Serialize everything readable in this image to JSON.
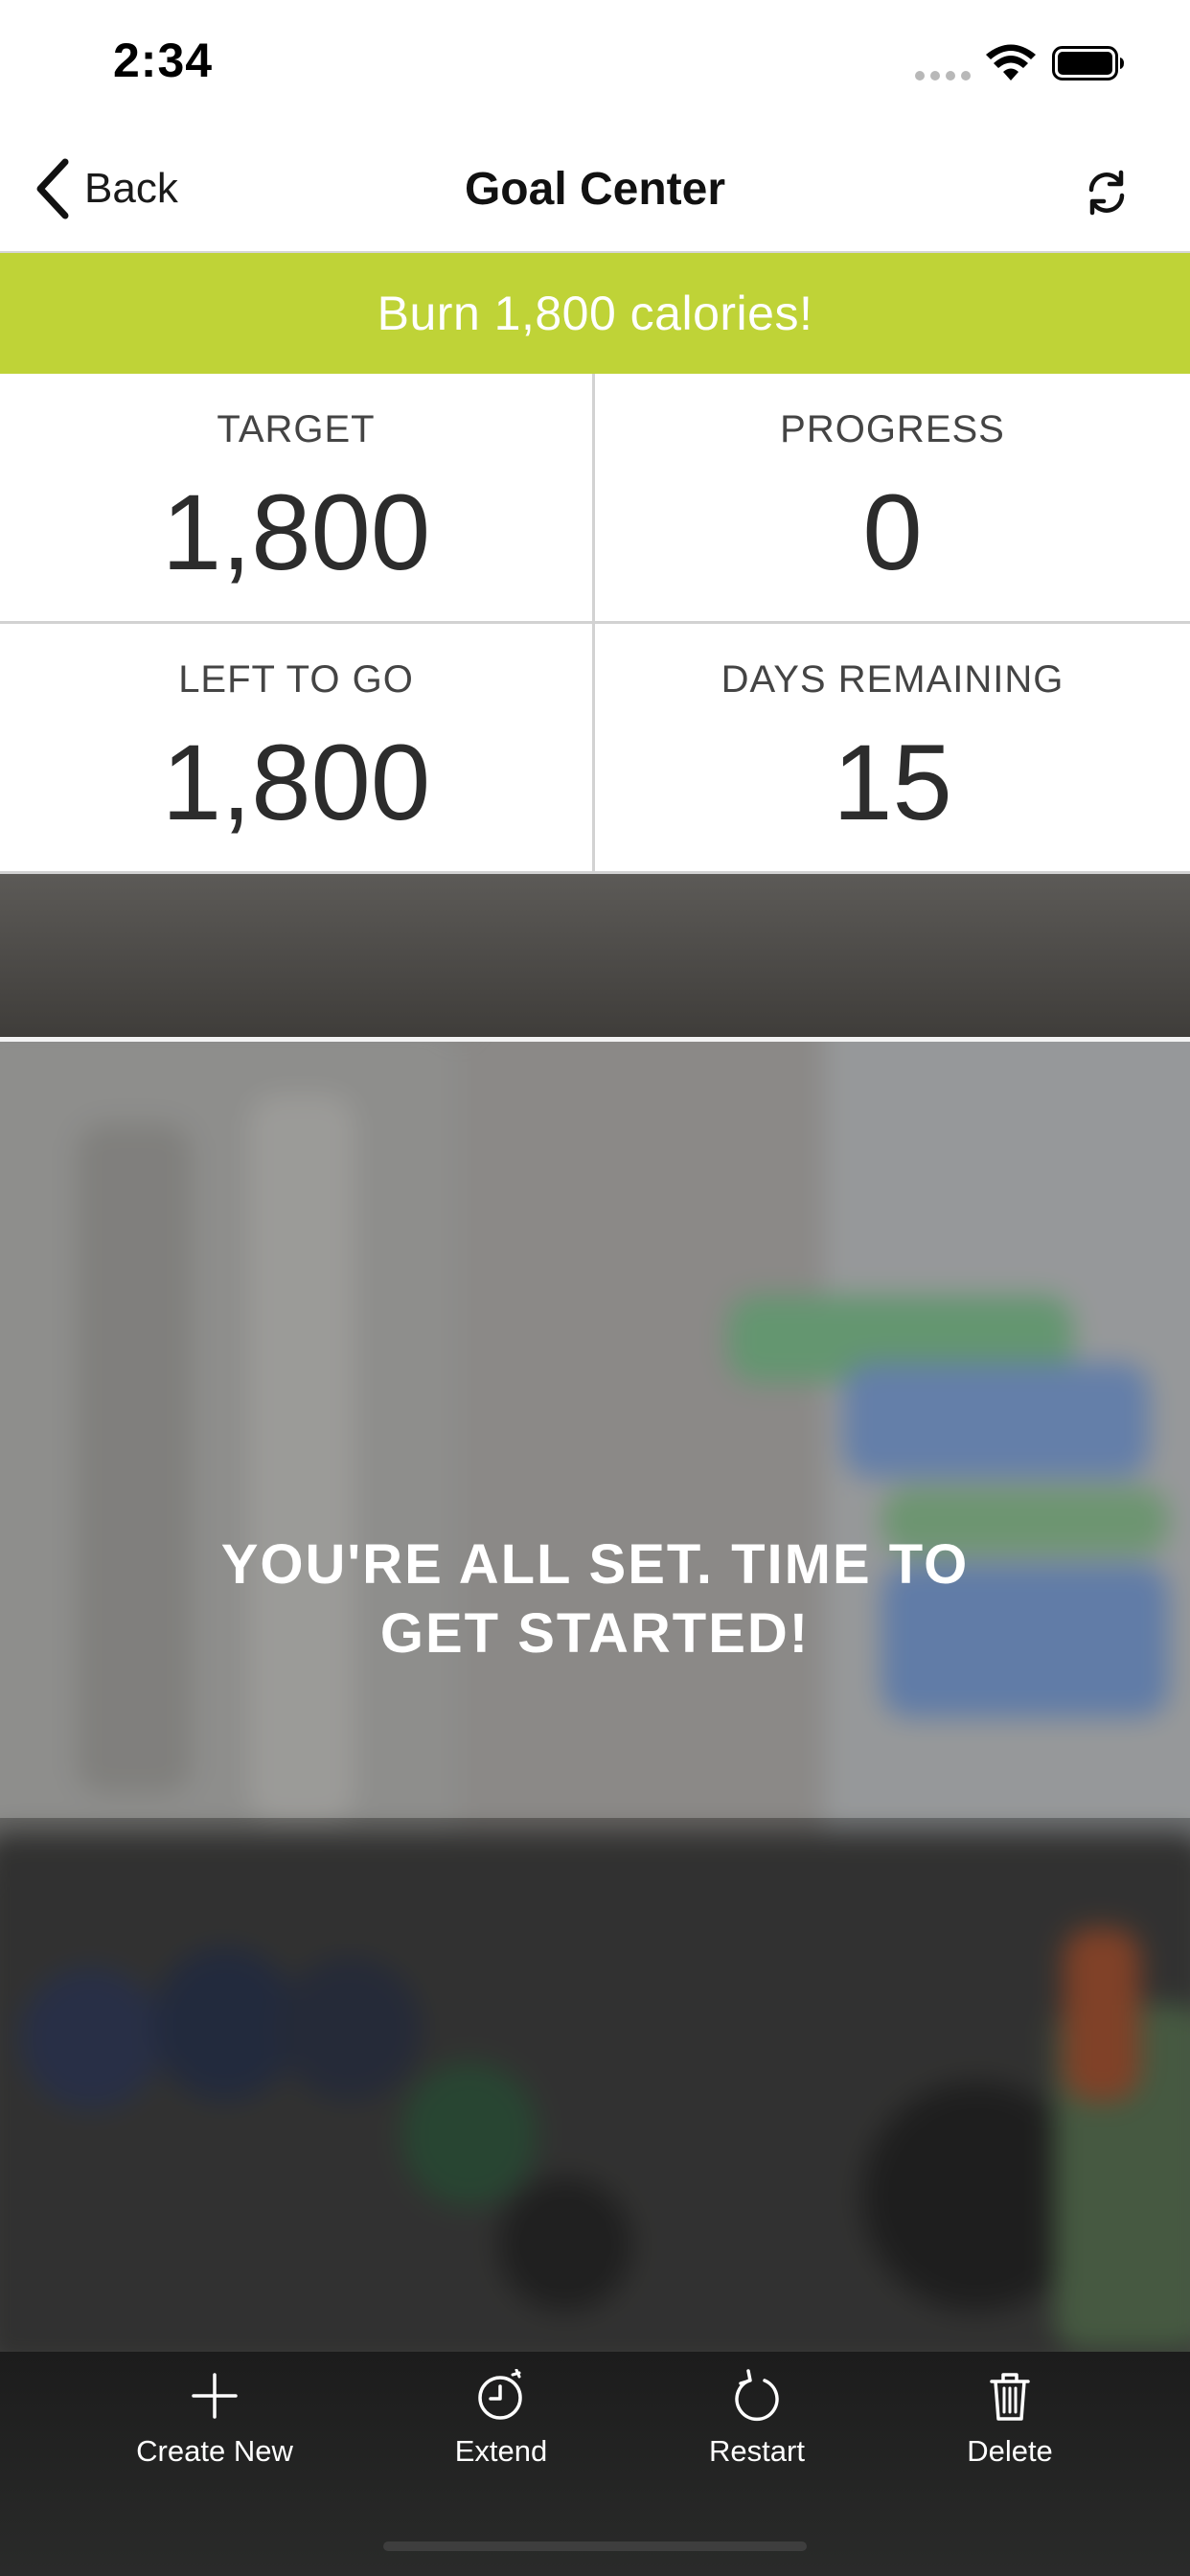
{
  "status_bar": {
    "time": "2:34"
  },
  "nav": {
    "back_label": "Back",
    "title": "Goal Center",
    "refresh_icon": "refresh-icon"
  },
  "goal": {
    "banner": "Burn 1,800 calories!",
    "banner_color": "#bfd337"
  },
  "stats": [
    {
      "label": "TARGET",
      "value": "1,800"
    },
    {
      "label": "PROGRESS",
      "value": "0"
    },
    {
      "label": "LEFT TO GO",
      "value": "1,800"
    },
    {
      "label": "DAYS REMAINING",
      "value": "15"
    }
  ],
  "message": {
    "line1": "YOU'RE ALL SET. TIME TO",
    "line2": "GET STARTED!"
  },
  "actions": [
    {
      "label": "Create New",
      "icon": "plus-icon"
    },
    {
      "label": "Extend",
      "icon": "clock-icon"
    },
    {
      "label": "Restart",
      "icon": "restart-icon"
    },
    {
      "label": "Delete",
      "icon": "trash-icon"
    }
  ]
}
